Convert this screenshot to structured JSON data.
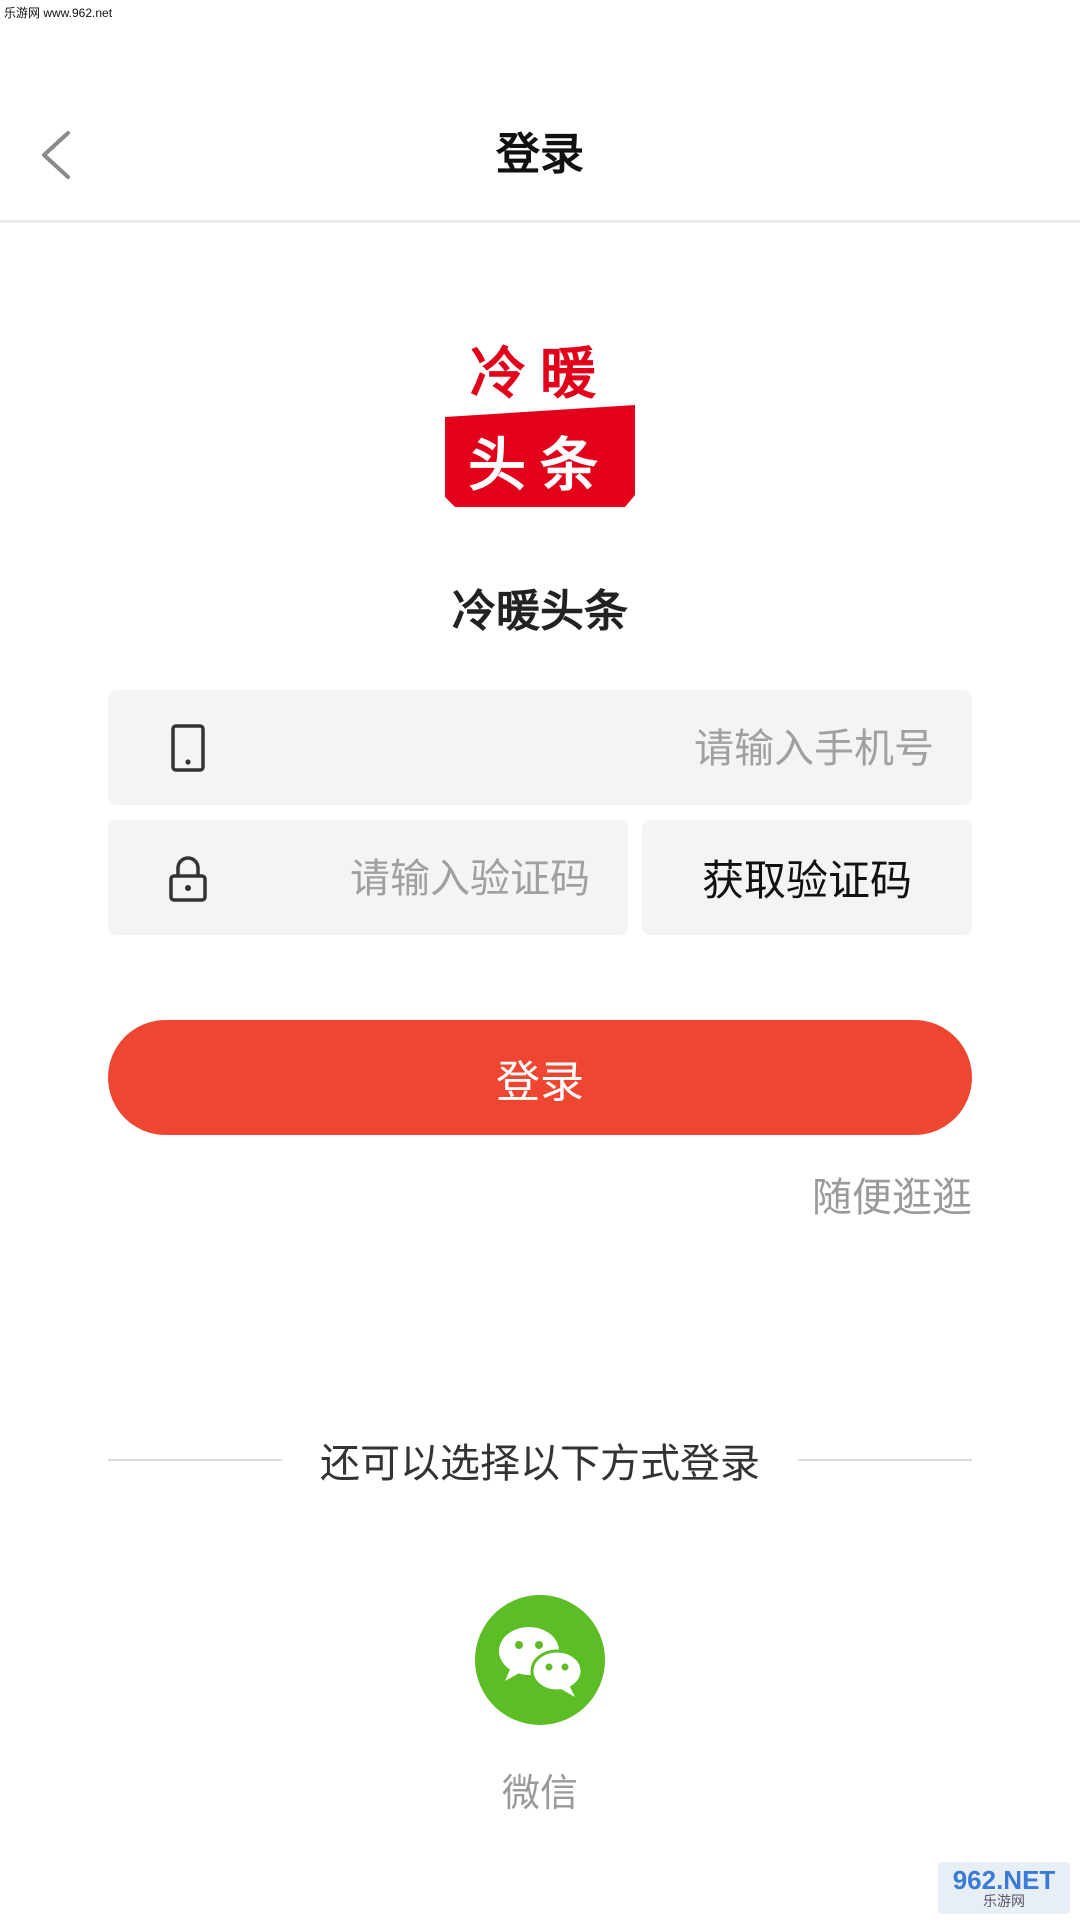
{
  "watermark_top": "乐游网 www.962.net",
  "header": {
    "title": "登录",
    "back_icon": "chevron-left-icon"
  },
  "logo": {
    "line1": "冷暖",
    "line2": "头条",
    "color_red": "#e2001a"
  },
  "app_name": "冷暖头条",
  "phone_field": {
    "placeholder": "请输入手机号",
    "value": "",
    "icon": "phone-icon"
  },
  "code_field": {
    "placeholder": "请输入验证码",
    "value": "",
    "icon": "lock-icon"
  },
  "get_code_label": "获取验证码",
  "login_label": "登录",
  "browse_label": "随便逛逛",
  "alt_login_text": "还可以选择以下方式登录",
  "wechat": {
    "label": "微信",
    "color": "#5cbd24",
    "icon": "wechat-icon"
  },
  "accent_color": "#ee4631",
  "watermark_bottom": {
    "num": "962.NET",
    "sub": "乐游网"
  }
}
